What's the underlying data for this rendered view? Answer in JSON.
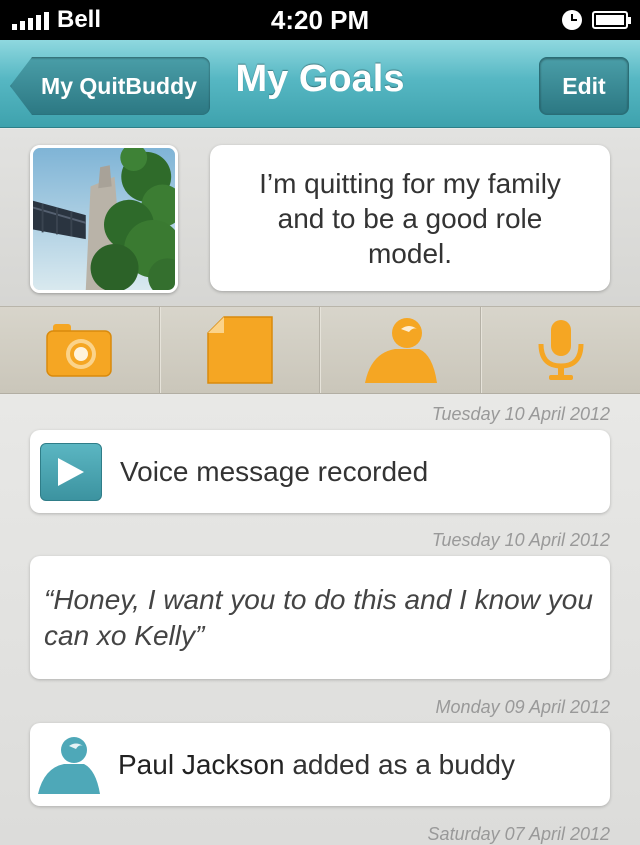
{
  "status_bar": {
    "carrier": "Bell",
    "time": "4:20 PM"
  },
  "nav": {
    "back_label": "My QuitBuddy",
    "title": "My Goals",
    "edit_label": "Edit"
  },
  "goal": {
    "statement": "I’m quitting for my family and to be a good role model."
  },
  "toolbar": {
    "items": [
      {
        "icon": "camera-icon"
      },
      {
        "icon": "note-icon"
      },
      {
        "icon": "person-icon"
      },
      {
        "icon": "microphone-icon"
      }
    ],
    "icon_color": "#f5a623"
  },
  "timeline": {
    "entries": [
      {
        "date": "Tuesday 10 April 2012",
        "text": "Voice message recorded",
        "icon": "play-icon"
      },
      {
        "date": "Tuesday 10 April 2012",
        "text": "“Honey, I want you to do this and I know you can xo Kelly”"
      },
      {
        "date": "Monday 09 April 2012",
        "buddy_name": "Paul Jackson",
        "text": " added as a buddy",
        "icon": "buddy-icon"
      },
      {
        "date": "Saturday 07 April 2012"
      }
    ]
  },
  "colors": {
    "nav_teal": "#56b7c3",
    "accent_orange": "#f5a623",
    "buddy_teal": "#4ea8b8"
  }
}
